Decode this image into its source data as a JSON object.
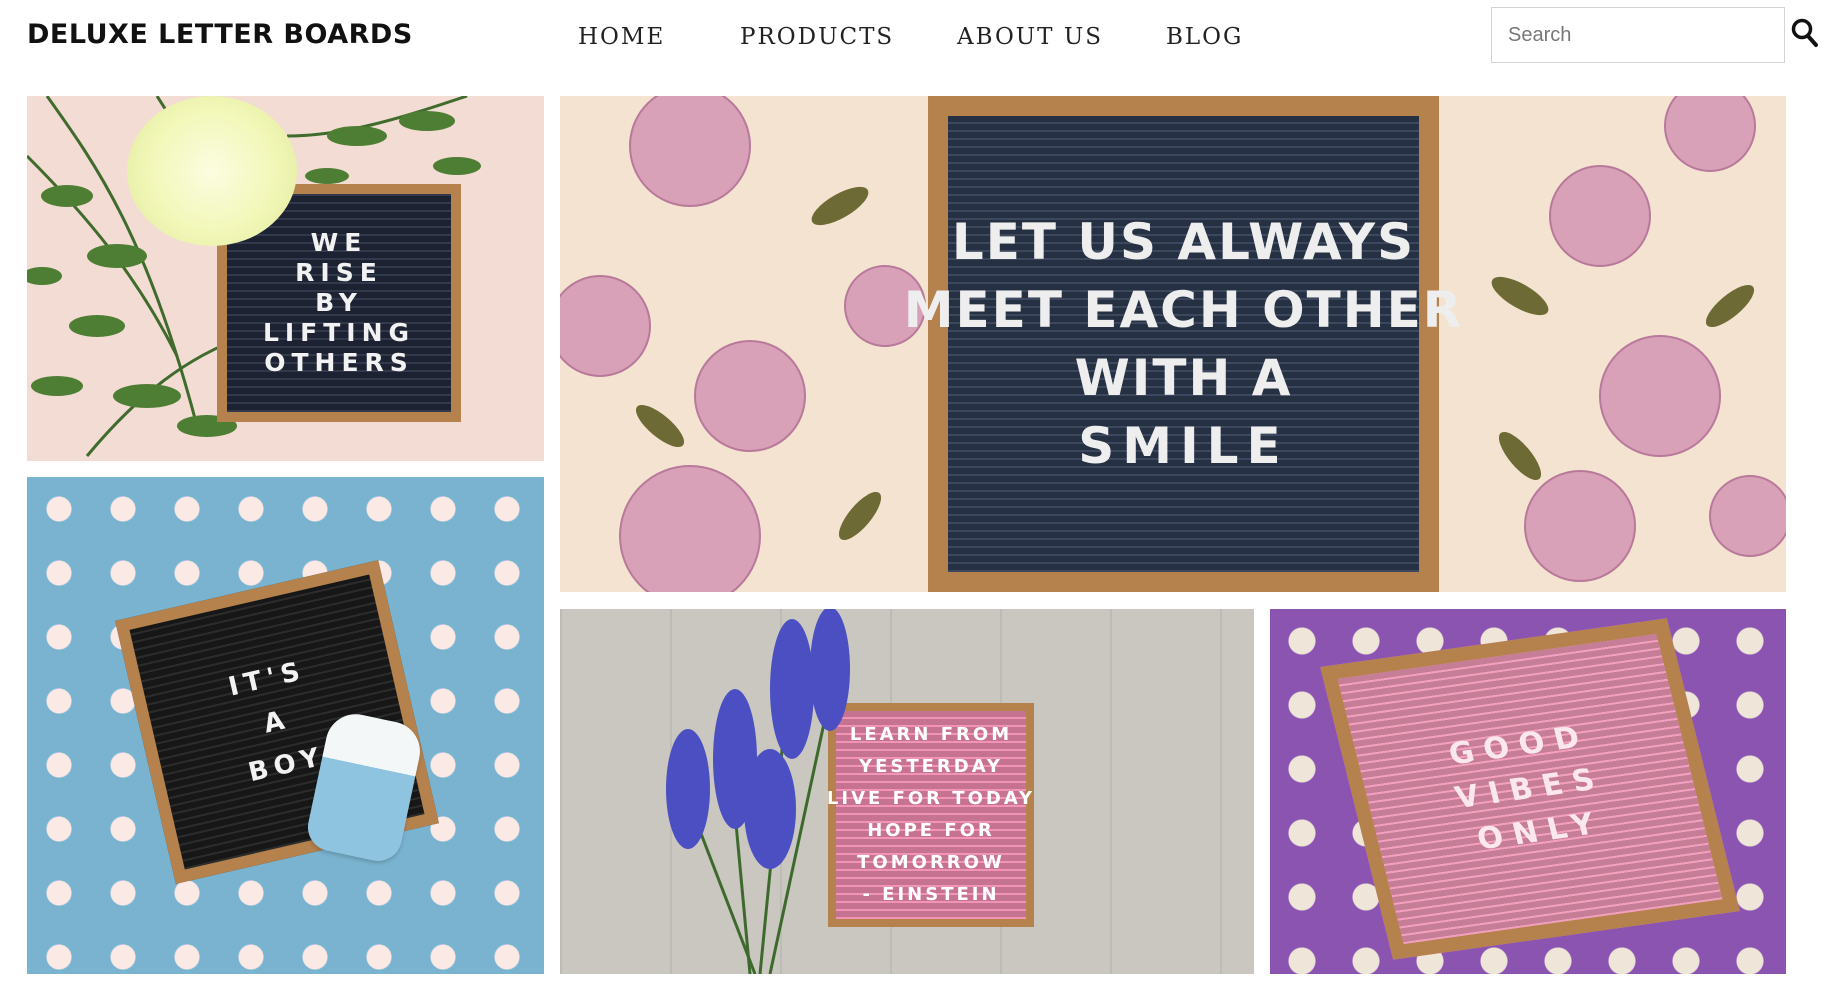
{
  "brand": {
    "logo_text": "DELUXE LETTER BOARDS"
  },
  "nav": {
    "items": [
      "HOME",
      "PRODUCTS",
      "ABOUT US",
      "BLOG"
    ]
  },
  "search": {
    "placeholder": "Search",
    "icon": "search-icon"
  },
  "gallery": {
    "tiles": [
      {
        "board_color": "#232a3d",
        "background": "blush pink with greenery and cream flower",
        "message": [
          "WE",
          "RISE",
          "BY",
          "LIFTING",
          "OTHERS"
        ]
      },
      {
        "board_color": "#2e3a52",
        "background": "floral wallpaper with pink peonies",
        "message": [
          "LET US ALWAYS",
          "MEET EACH OTHER",
          "WITH  A",
          "SMILE"
        ]
      },
      {
        "board_color": "#1c1c1c",
        "background": "blue polka dot with sippy cup",
        "message": [
          "IT'S",
          "A",
          "BOY"
        ]
      },
      {
        "board_color": "#f08cb0",
        "background": "grey wood planks with lavender",
        "message": [
          "LEARN FROM",
          "YESTERDAY",
          "LIVE FOR TODAY",
          "HOPE FOR",
          "TOMORROW",
          "- EINSTEIN"
        ]
      },
      {
        "board_color": "#f199b8",
        "background": "purple polka dot",
        "message": [
          "GOOD",
          "VIBES",
          "ONLY"
        ]
      }
    ]
  },
  "colors": {
    "frame": "#b5824e",
    "text": "#222222",
    "dot_blue": "#7ab3cf",
    "dot_purple": "#8b54b1"
  }
}
